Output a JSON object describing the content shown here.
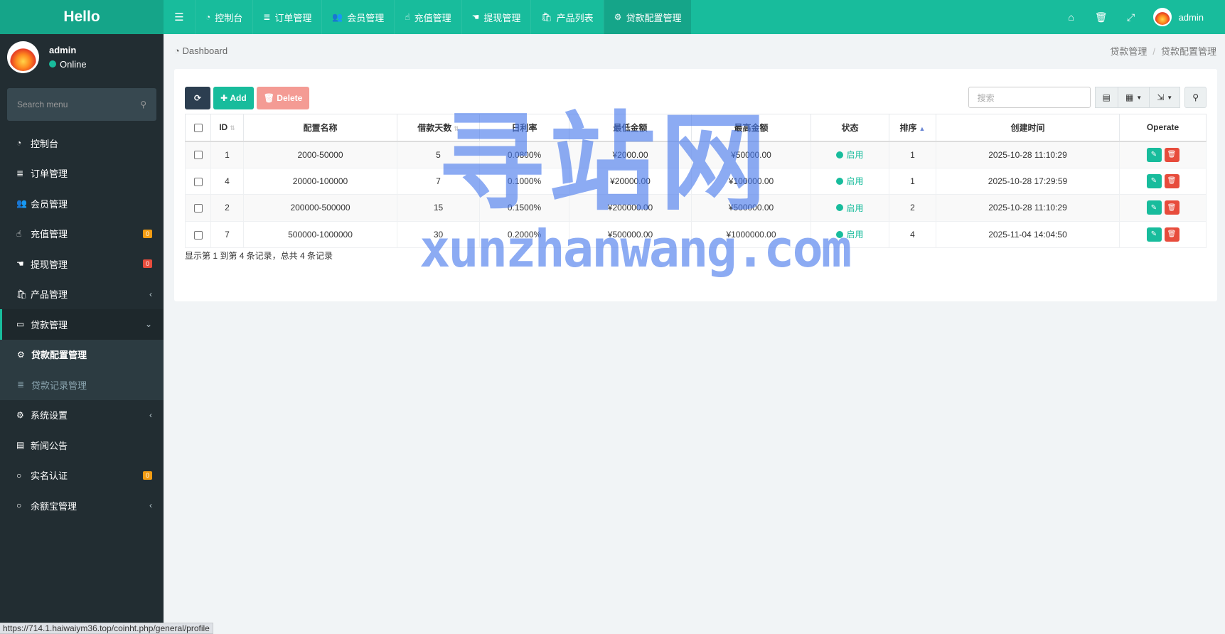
{
  "logo": "Hello",
  "topnav": {
    "tabs": [
      {
        "icon": "☰",
        "label": ""
      },
      {
        "icon": "◔",
        "label": "控制台"
      },
      {
        "icon": "≣",
        "label": "订单管理"
      },
      {
        "icon": "👥",
        "label": "会员管理"
      },
      {
        "icon": "☝",
        "label": "充值管理"
      },
      {
        "icon": "☚",
        "label": "提现管理"
      },
      {
        "icon": "🛍",
        "label": "产品列表"
      },
      {
        "icon": "⚙",
        "label": "贷款配置管理"
      }
    ],
    "user": "admin"
  },
  "sidebar": {
    "username": "admin",
    "status": "Online",
    "search_placeholder": "Search menu",
    "items": [
      {
        "icon": "◔",
        "label": "控制台",
        "badge": "",
        "arrow": ""
      },
      {
        "icon": "≣",
        "label": "订单管理",
        "badge": "",
        "arrow": ""
      },
      {
        "icon": "👥",
        "label": "会员管理",
        "badge": "",
        "arrow": ""
      },
      {
        "icon": "☝",
        "label": "充值管理",
        "badge": "0",
        "arrow": ""
      },
      {
        "icon": "☚",
        "label": "提现管理",
        "badge": "0",
        "arrow": ""
      },
      {
        "icon": "🛍",
        "label": "产品管理",
        "badge": "",
        "arrow": "‹"
      },
      {
        "icon": "▭",
        "label": "贷款管理",
        "badge": "",
        "arrow": "⌄"
      },
      {
        "icon": "⚙",
        "label": "系统设置",
        "badge": "",
        "arrow": "‹"
      },
      {
        "icon": "▤",
        "label": "新闻公告",
        "badge": "",
        "arrow": ""
      },
      {
        "icon": "○",
        "label": "实名认证",
        "badge": "0",
        "arrow": ""
      },
      {
        "icon": "○",
        "label": "余额宝管理",
        "badge": "",
        "arrow": "‹"
      }
    ],
    "subitems": [
      {
        "icon": "⚙",
        "label": "贷款配置管理"
      },
      {
        "icon": "≣",
        "label": "贷款记录管理"
      }
    ]
  },
  "breadcrumb": {
    "left": "Dashboard",
    "parent": "贷款管理",
    "current": "贷款配置管理"
  },
  "toolbar": {
    "add": "Add",
    "delete": "Delete",
    "search_placeholder": "搜索"
  },
  "table": {
    "headers": [
      "ID",
      "配置名称",
      "借款天数",
      "日利率",
      "最低金额",
      "最高金额",
      "状态",
      "排序",
      "创建时间",
      "Operate"
    ],
    "rows": [
      {
        "id": "1",
        "name": "2000-50000",
        "days": "5",
        "rate": "0.0800%",
        "min": "¥2000.00",
        "max": "¥50000.00",
        "status": "启用",
        "sort": "1",
        "created": "2025-10-28 11:10:29"
      },
      {
        "id": "4",
        "name": "20000-100000",
        "days": "7",
        "rate": "0.1000%",
        "min": "¥20000.00",
        "max": "¥100000.00",
        "status": "启用",
        "sort": "1",
        "created": "2025-10-28 17:29:59"
      },
      {
        "id": "2",
        "name": "200000-500000",
        "days": "15",
        "rate": "0.1500%",
        "min": "¥200000.00",
        "max": "¥500000.00",
        "status": "启用",
        "sort": "2",
        "created": "2025-10-28 11:10:29"
      },
      {
        "id": "7",
        "name": "500000-1000000",
        "days": "30",
        "rate": "0.2000%",
        "min": "¥500000.00",
        "max": "¥1000000.00",
        "status": "启用",
        "sort": "4",
        "created": "2025-11-04 14:04:50"
      }
    ],
    "footer": "显示第 1 到第 4 条记录，总共 4 条记录"
  },
  "watermark": {
    "big": "寻站网",
    "small": "xunzhanwang.com"
  },
  "statusbar": "https://714.1.haiwaiym36.top/coinht.php/general/profile"
}
